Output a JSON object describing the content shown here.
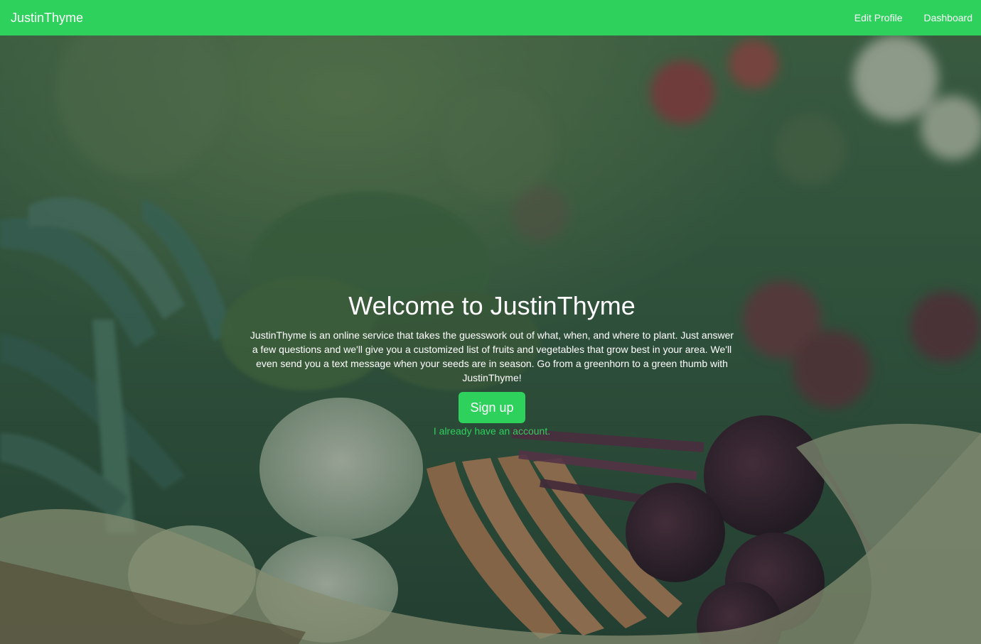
{
  "navbar": {
    "brand": "JustinThyme",
    "links": [
      "Edit Profile",
      "Dashboard"
    ]
  },
  "hero": {
    "title": "Welcome to JustinThyme",
    "description": "JustinThyme is an online service that takes the guesswork out of what, when, and where to plant. Just answer a few questions and we'll give you a customized list of fruits and vegetables that grow best in your area. We'll even send you a text message when your seeds are in season. Go from a greenhorn to a green thumb with JustinThyme!",
    "signup_label": "Sign up",
    "login_link": "I already have an account."
  },
  "colors": {
    "brand_green": "#2dd15c",
    "text_white": "#ffffff"
  }
}
